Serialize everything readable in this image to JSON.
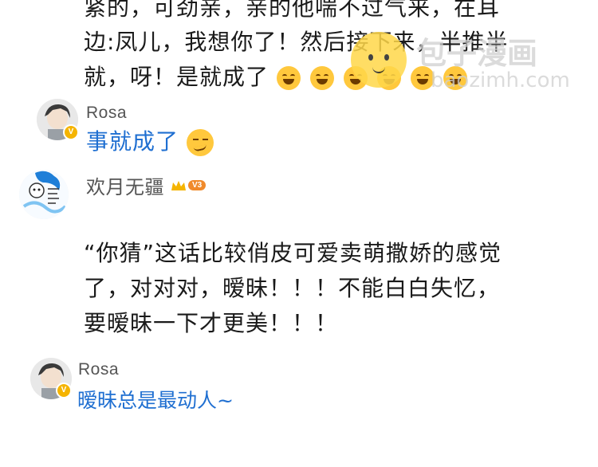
{
  "top_comment": {
    "line1": "紧的，可劲亲，亲的他喘不过气来，在耳",
    "line2": "边:凤儿，我想你了！然后接下来，半推半",
    "line3": "就，呀！是就成了"
  },
  "reply1": {
    "username": "Rosa",
    "text": "事就成了",
    "badge": "V"
  },
  "comment2": {
    "username": "欢月无疆",
    "level_badge": "V3",
    "line1": "“你猜”这话比较俏皮可爱卖萌撒娇的感觉",
    "line2": "了，对对对，暧昧！！！不能白白失忆，",
    "line3": "要暧昧一下才更美！！！"
  },
  "reply2": {
    "username": "Rosa",
    "text": "暧昧总是最动人~",
    "badge": "V"
  },
  "watermark": {
    "brand": "包子漫画",
    "url": "baozimh.com"
  },
  "colors": {
    "link": "#1f6fd1",
    "vip_gold": "#f5b400",
    "emoji": "#ffc83d"
  }
}
